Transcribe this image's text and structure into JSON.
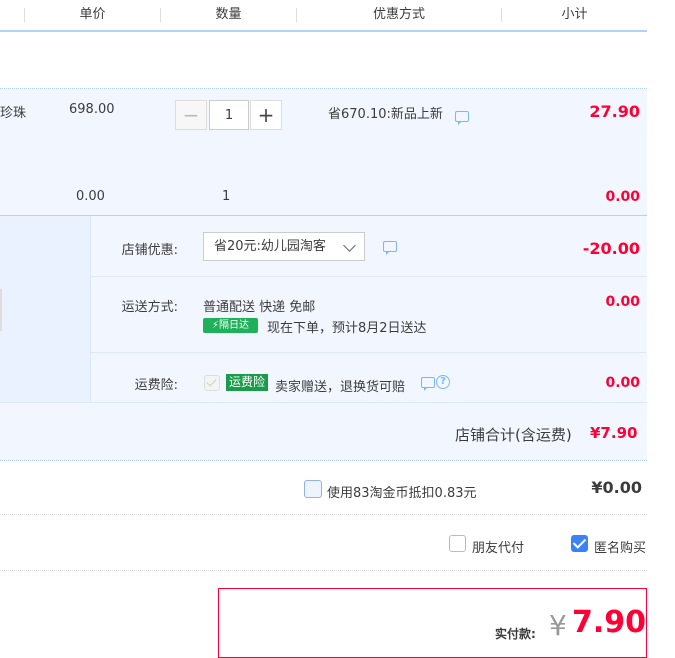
{
  "header": {
    "price": "单价",
    "quantity": "数量",
    "discount": "优惠方式",
    "subtotal": "小计"
  },
  "product": {
    "name_fragment": "珍珠",
    "price": "698.00",
    "quantity": "1",
    "discount_text": "省670.10:新品上新",
    "subtotal": "27.90"
  },
  "subrow": {
    "price": "0.00",
    "quantity": "1",
    "subtotal": "0.00"
  },
  "store": {
    "coupon_label": "店铺优惠:",
    "coupon_value": "省20元:幼儿园淘客",
    "coupon_amount": "-20.00",
    "shipping_label": "运送方式:",
    "shipping_method": "普通配送 快递 免邮",
    "fast_badge": "隔日达",
    "shipping_note": "现在下单，预计8月2日送达",
    "shipping_amount": "0.00",
    "insurance_label": "运费险:",
    "insurance_badge": "运费险",
    "insurance_note": "卖家赠送，退换货可赔",
    "insurance_amount": "0.00",
    "total_label": "店铺合计(含运费)",
    "total_amount": "¥7.90"
  },
  "coins": {
    "label": "使用83淘金币抵扣0.83元",
    "amount": "¥0.00"
  },
  "options": {
    "friend_pay": "朋友代付",
    "anonymous": "匿名购买"
  },
  "payment": {
    "label": "实付款:",
    "currency": "¥",
    "amount": "7.90"
  },
  "colors": {
    "accent_red": "#ff0036",
    "border_blue": "#b2d1ff",
    "row_bg": "#f2f7ff",
    "badge_green": "#1fb15a"
  },
  "icons": [
    "chat-icon",
    "chevron-down-icon",
    "lightning-icon",
    "question-icon",
    "checkbox-icon"
  ]
}
